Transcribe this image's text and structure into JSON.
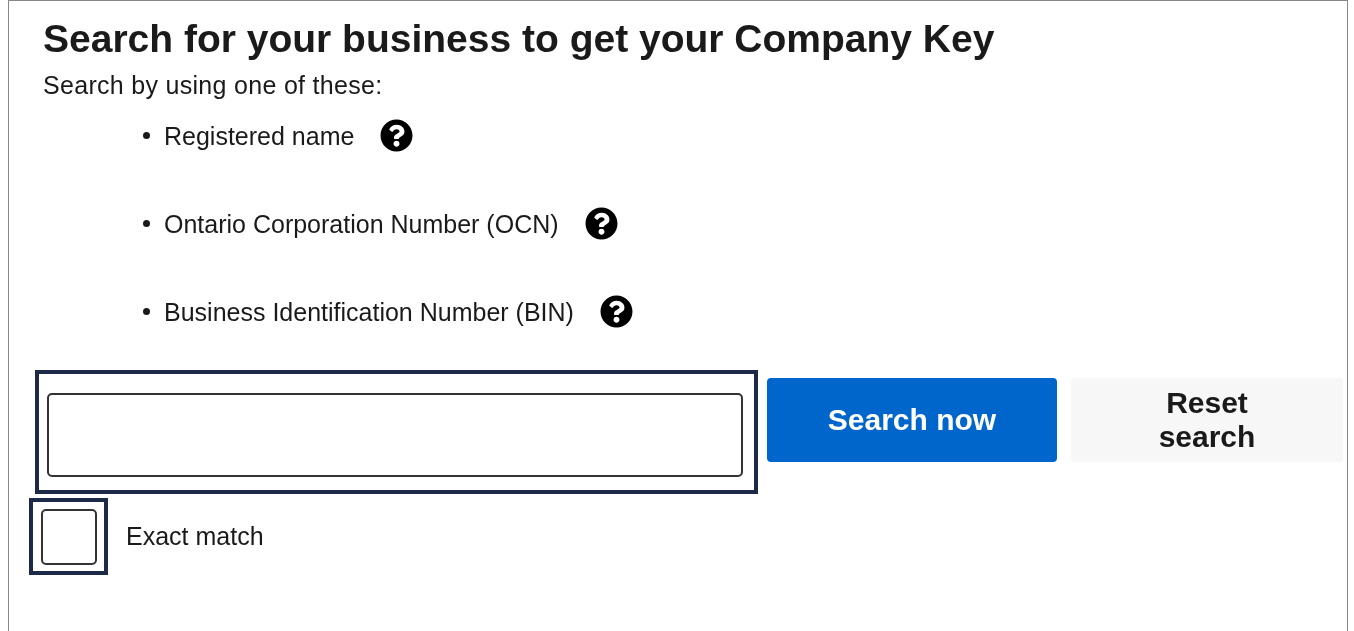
{
  "title": "Search for your business to get your Company Key",
  "intro": "Search by using one of these:",
  "options": [
    {
      "label": "Registered name"
    },
    {
      "label": "Ontario Corporation Number (OCN)"
    },
    {
      "label": "Business Identification Number (BIN)"
    }
  ],
  "search_field": {
    "highlighted": true
  },
  "buttons": [
    {
      "label": "Search now",
      "kind": "primary"
    },
    {
      "label": "Reset search",
      "kind": "secondary"
    }
  ],
  "exact_match": {
    "label": "Exact match",
    "checked": false,
    "highlighted": true
  }
}
